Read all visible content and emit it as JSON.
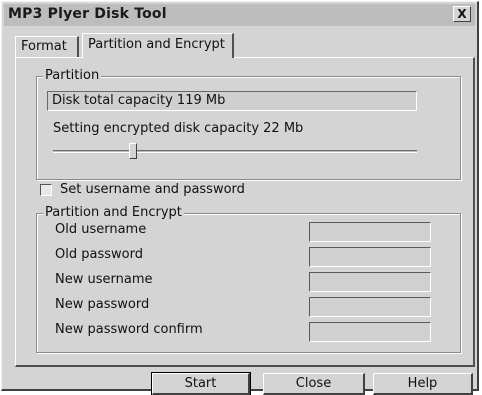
{
  "window": {
    "title": "MP3 Plyer Disk Tool",
    "close_glyph": "X"
  },
  "tabs": [
    {
      "label": "Format"
    },
    {
      "label": "Partition and Encrypt"
    }
  ],
  "partition": {
    "legend": "Partition",
    "total_capacity": "Disk total capacity 119 Mb",
    "encrypted_capacity": "Setting encrypted disk capacity 22 Mb",
    "slider_fraction": 0.22
  },
  "credentials_toggle": {
    "label": "Set username and password",
    "checked": false
  },
  "encrypt": {
    "legend": "Partition and Encrypt",
    "fields": [
      {
        "label": "Old username",
        "value": ""
      },
      {
        "label": "Old password",
        "value": ""
      },
      {
        "label": "New username",
        "value": ""
      },
      {
        "label": "New password",
        "value": ""
      },
      {
        "label": "New password confirm",
        "value": ""
      }
    ]
  },
  "buttons": {
    "start": "Start",
    "close": "Close",
    "help": "Help"
  }
}
